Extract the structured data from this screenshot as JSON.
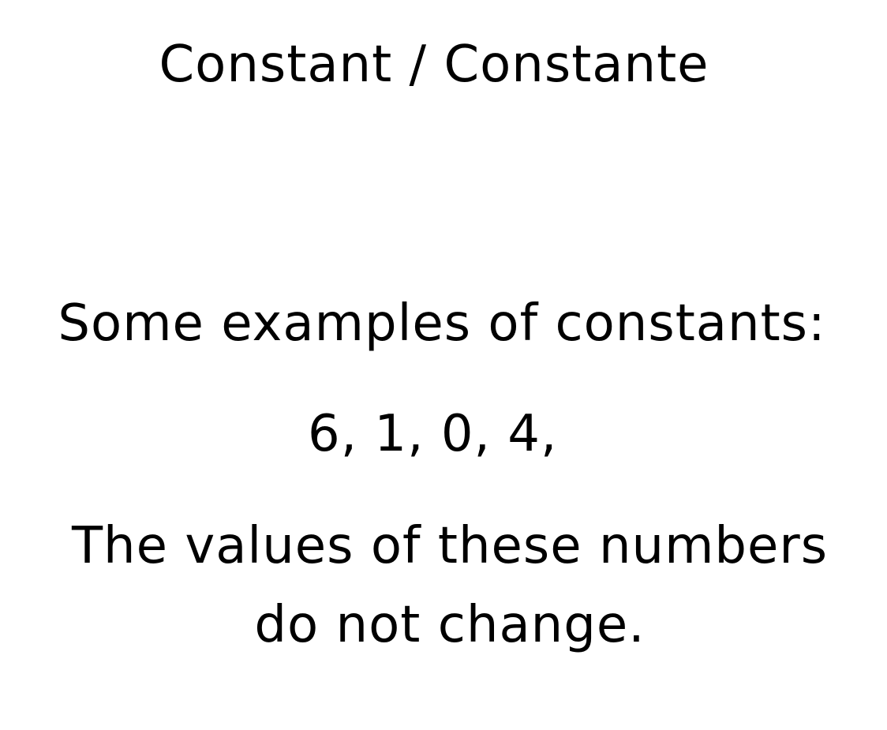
{
  "slide": {
    "title": "Constant / Constante",
    "intro": "Some examples of constants:",
    "numbers": "6, 1, 0, 4,",
    "explanation_line1": "The values of these numbers",
    "explanation_line2": "do not change."
  }
}
